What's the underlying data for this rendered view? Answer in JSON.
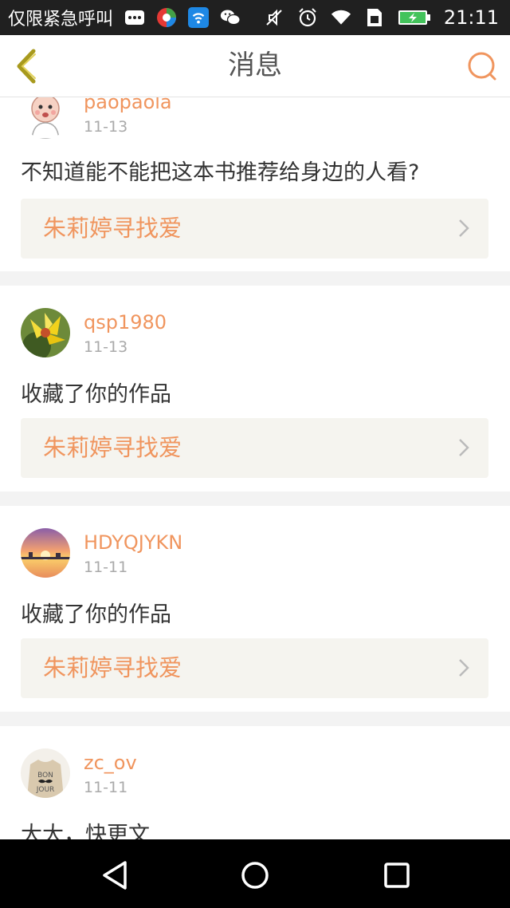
{
  "status_bar": {
    "carrier": "仅限紧急呼叫",
    "time": "21:11"
  },
  "header": {
    "title": "消息"
  },
  "messages": [
    {
      "username": "paopaola",
      "date": "11-13",
      "text": "不知道能不能把这本书推荐给身边的人看?",
      "book": "朱莉婷寻找爱"
    },
    {
      "username": "qsp1980",
      "date": "11-13",
      "text": "收藏了你的作品",
      "book": "朱莉婷寻找爱"
    },
    {
      "username": "HDYQJYKN",
      "date": "11-11",
      "text": "收藏了你的作品",
      "book": "朱莉婷寻找爱"
    },
    {
      "username": "zc_ov",
      "date": "11-11",
      "text": "大大，快更文"
    }
  ],
  "colors": {
    "accent": "#f0955e",
    "card_bg": "#ffffff",
    "page_bg": "#f3f3f3",
    "book_bg": "#f5f4ef"
  }
}
